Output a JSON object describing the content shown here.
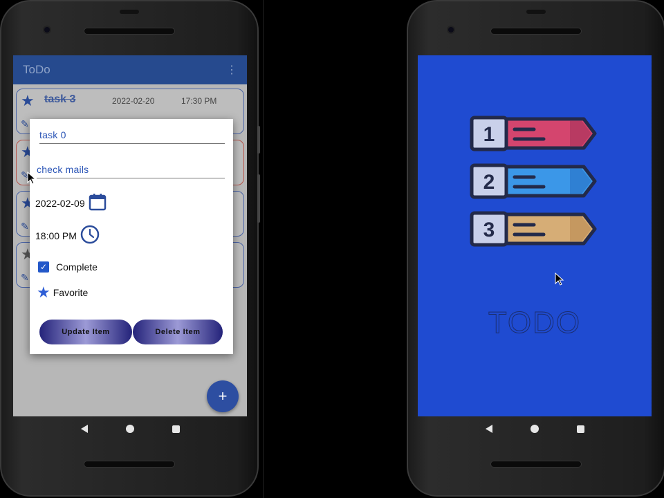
{
  "left_phone": {
    "app_title": "ToDo",
    "menu_icon": "overflow-menu-icon",
    "cards": [
      {
        "title": "task 3",
        "date": "2022-02-20",
        "time": "17:30 PM"
      }
    ],
    "dialog": {
      "name_value": "task 0",
      "description_value": "check mails",
      "date_value": "2022-02-09",
      "time_value": "18:00 PM",
      "complete_label": "Complete",
      "complete_checked": true,
      "favorite_label": "Favorite",
      "update_label": "Update Item",
      "delete_label": "Delete Item"
    },
    "fab_label": "+"
  },
  "right_phone": {
    "splash_text": "TODO",
    "list_numbers": [
      "1",
      "2",
      "3"
    ],
    "colors": {
      "background": "#1f4bd1",
      "item1": "#d4456e",
      "item2": "#3b97e8",
      "item3": "#d6ad76"
    }
  }
}
